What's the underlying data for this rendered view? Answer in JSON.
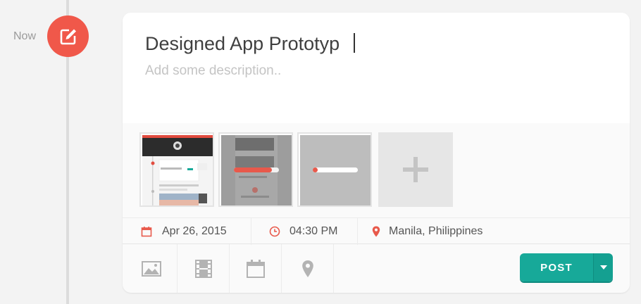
{
  "timeline": {
    "now_label": "Now",
    "icon": "edit-icon",
    "accent": "#f0584a"
  },
  "composer": {
    "title_value": "Designed App Prototyp",
    "description_placeholder": "Add some description.."
  },
  "attachments": {
    "thumbnails": [
      "screenshot-thumbnail",
      "screenshot-thumbnail",
      "uploading-thumbnail"
    ],
    "upload_progress": 0.1,
    "add_icon": "plus-icon"
  },
  "meta": {
    "date": "Apr 26, 2015",
    "time": "04:30 PM",
    "location": "Manila, Philippines",
    "icon_color": "#e8594b"
  },
  "toolbar": {
    "tools": [
      "image-icon",
      "film-icon",
      "calendar-icon",
      "location-pin-icon"
    ],
    "post_label": "POST",
    "post_color": "#17a999"
  }
}
